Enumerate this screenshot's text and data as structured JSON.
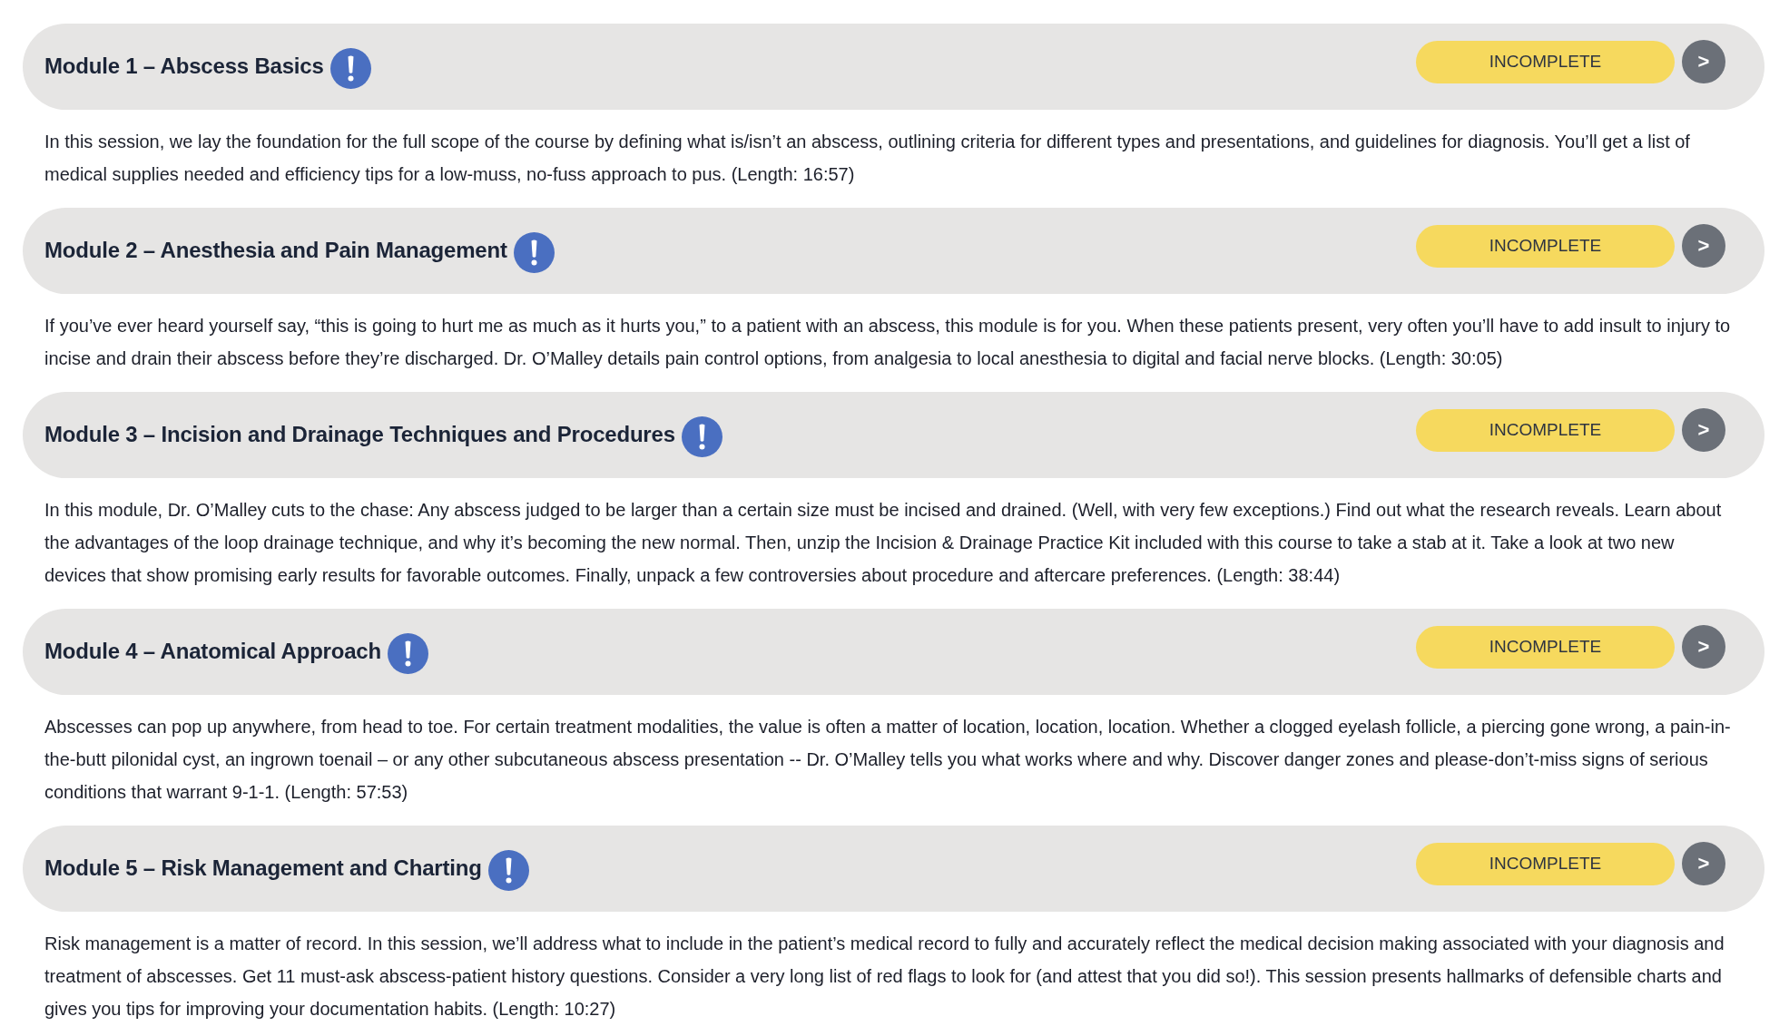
{
  "modules": [
    {
      "title": "Module 1 – Abscess Basics",
      "completed": false,
      "status": "INCOMPLETE",
      "action": ">",
      "description": "In this session, we lay the foundation for the full scope of the course by defining what is/isn’t an abscess, outlining criteria for different types and presentations, and guidelines for diagnosis. You’ll get a list of medical supplies needed and efficiency tips for a low-muss, no-fuss approach to pus. (Length: 16:57)"
    },
    {
      "title": "Module 2 – Anesthesia and Pain Management",
      "completed": false,
      "status": "INCOMPLETE",
      "action": ">",
      "description": "If you’ve ever heard yourself say, “this is going to hurt me as much as it hurts you,” to a patient with an abscess, this module is for you. When these patients present, very often you’ll have to add insult to injury to incise and drain their abscess before they’re discharged. Dr. O’Malley details pain control options, from analgesia to local anesthesia to digital and facial nerve blocks. (Length: 30:05)"
    },
    {
      "title": "Module 3 – Incision and Drainage Techniques and Procedures",
      "completed": false,
      "status": "INCOMPLETE",
      "action": ">",
      "description": "In this module, Dr. O’Malley cuts to the chase: Any abscess judged to be larger than a certain size must be incised and drained. (Well, with very few exceptions.) Find out what the research reveals. Learn about the advantages of the loop drainage technique, and why it’s becoming the new normal. Then, unzip the Incision & Drainage Practice Kit included with this course to take a stab at it. Take a look at two new devices that show promising early results for favorable outcomes. Finally, unpack a few controversies about procedure and aftercare preferences. (Length: 38:44)"
    },
    {
      "title": "Module 4 – Anatomical Approach",
      "completed": false,
      "status": "INCOMPLETE",
      "action": ">",
      "description": "Abscesses can pop up anywhere, from head to toe. For certain treatment modalities, the value is often a matter of location, location, location. Whether a clogged eyelash follicle, a piercing gone wrong, a pain-in-the-butt pilonidal cyst, an ingrown toenail – or any other subcutaneous abscess presentation -- Dr. O’Malley tells you what works where and why. Discover danger zones and please-don’t-miss signs of serious conditions that warrant 9-1-1. (Length: 57:53)"
    },
    {
      "title": "Module 5 – Risk Management and Charting",
      "completed": false,
      "status": "INCOMPLETE",
      "action": ">",
      "description": "Risk management is a matter of record. In this session, we’ll address what to include in the patient’s medical record to fully and accurately reflect the medical decision making associated with your diagnosis and treatment of abscesses. Get 11 must-ask abscess-patient history questions. Consider a very long list of red flags to look for (and attest that you did so!). This session presents hallmarks of defensible charts and gives you tips for improving your documentation habits. (Length: 10:27)"
    }
  ]
}
